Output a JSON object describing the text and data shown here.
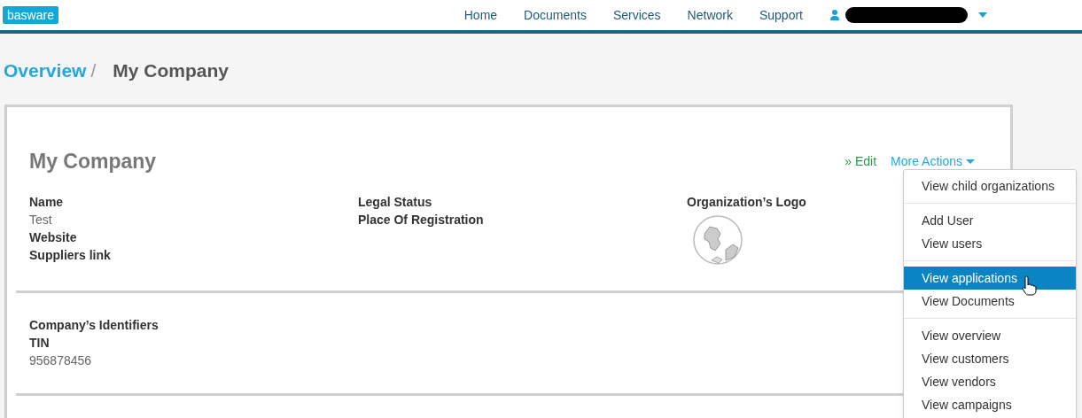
{
  "header": {
    "logo": "basware",
    "nav": [
      {
        "label": "Home"
      },
      {
        "label": "Documents"
      },
      {
        "label": "Services"
      },
      {
        "label": "Network"
      },
      {
        "label": "Support"
      }
    ],
    "user": {
      "redacted": true
    }
  },
  "breadcrumb": [
    {
      "label": "Overview",
      "kind": "link"
    },
    {
      "label": "My Company",
      "kind": "current",
      "separator": "/"
    }
  ],
  "company": {
    "title": "My Company",
    "actions": {
      "edit": "» Edit",
      "more": "More Actions"
    },
    "columns": [
      {
        "fields": [
          {
            "label": "Name",
            "value": "Test"
          },
          {
            "label": "Website"
          },
          {
            "label": "Suppliers link"
          }
        ]
      },
      {
        "fields": [
          {
            "label": "Legal Status"
          },
          {
            "label": "Place Of Registration"
          }
        ]
      },
      {
        "fields": [
          {
            "label": "Organization’s Logo"
          }
        ],
        "logo": true
      }
    ],
    "identifiers": {
      "title": "Company’s Identifiers",
      "fields": [
        {
          "label": "TIN",
          "value": "956878456"
        }
      ]
    }
  },
  "menu": {
    "groups": [
      {
        "items": [
          {
            "label": "View child organizations",
            "selected": false
          }
        ]
      },
      {
        "items": [
          {
            "label": "Add User",
            "selected": false
          },
          {
            "label": "View users",
            "selected": false
          }
        ]
      },
      {
        "items": [
          {
            "label": "View applications",
            "selected": true
          },
          {
            "label": "View Documents",
            "selected": false
          }
        ]
      },
      {
        "items": [
          {
            "label": "View overview",
            "selected": false
          },
          {
            "label": "View customers",
            "selected": false
          },
          {
            "label": "View vendors",
            "selected": false
          },
          {
            "label": "View campaigns",
            "selected": false
          }
        ]
      }
    ]
  }
}
